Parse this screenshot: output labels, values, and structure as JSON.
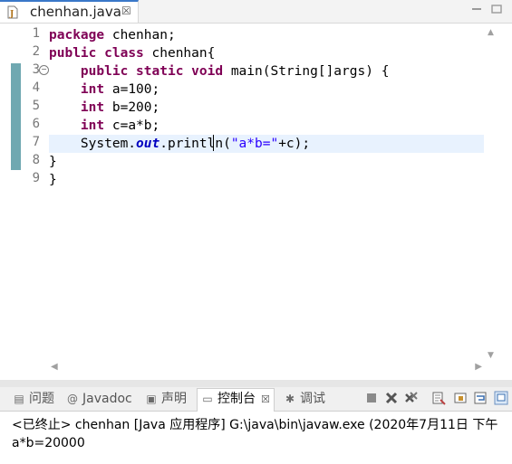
{
  "editor": {
    "tab": {
      "label": "chenhan.java",
      "close": "☒"
    },
    "line_numbers": [
      "1",
      "2",
      "3",
      "4",
      "5",
      "6",
      "7",
      "8",
      "9"
    ],
    "code": {
      "l1": {
        "kw": "package",
        "rest": " chenhan;"
      },
      "l2": {
        "kw1": "public",
        "sp1": " ",
        "kw2": "class",
        "rest": " chenhan{"
      },
      "l3": {
        "indent": "    ",
        "kw1": "public",
        "sp1": " ",
        "kw2": "static",
        "sp2": " ",
        "kw3": "void",
        "rest": " main(String[]args) {"
      },
      "l4": {
        "indent": "    ",
        "kw": "int",
        "rest": " a=100;"
      },
      "l5": {
        "indent": "    ",
        "kw": "int",
        "rest": " b=200;"
      },
      "l6": {
        "indent": "    ",
        "kw": "int",
        "rest": " c=a*b;"
      },
      "l7": {
        "indent": "    ",
        "pre": "System.",
        "field": "out",
        "mid": ".println(",
        "str": "\"a*b=\"",
        "post": "+c);"
      },
      "l8": {
        "text": "}"
      },
      "l9": {
        "text": "}"
      }
    },
    "fold_marker": "−"
  },
  "console": {
    "tabs": [
      {
        "icon": "▤",
        "label": "问题"
      },
      {
        "icon": "@",
        "label": "Javadoc"
      },
      {
        "icon": "▣",
        "label": "声明"
      },
      {
        "icon": "▭",
        "label": "控制台",
        "close": "☒"
      },
      {
        "icon": "✱",
        "label": "调试"
      }
    ],
    "status_line": "<已终止> chenhan [Java 应用程序] G:\\java\\bin\\javaw.exe  (2020年7月11日 下午",
    "output_line": "a*b=20000"
  },
  "colors": {
    "keyword": "#7f0055",
    "string": "#2a00ff",
    "field": "#0000c0",
    "current_line": "#e8f2fe",
    "change_bar": "#5f9ea8"
  }
}
